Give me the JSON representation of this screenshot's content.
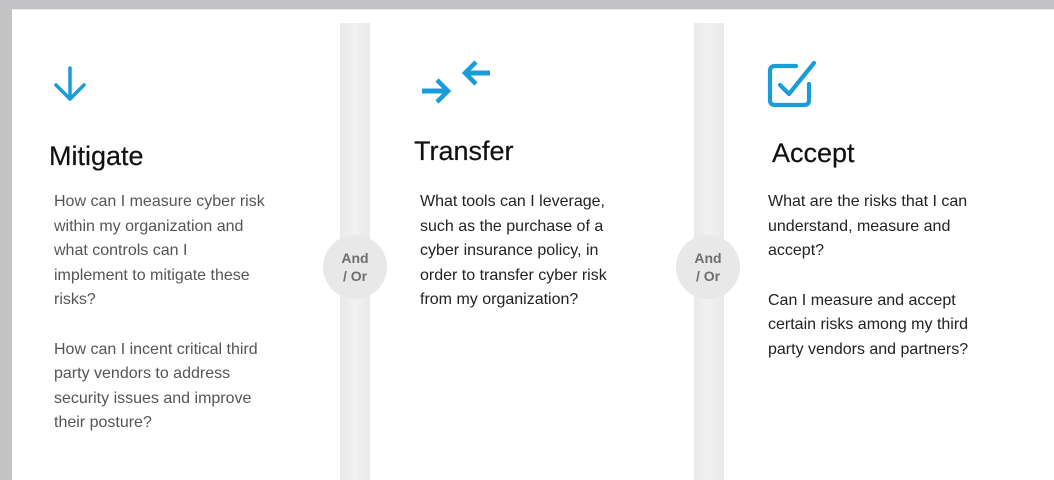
{
  "colors": {
    "accent": "#1a9cd8",
    "title_text": "#111111",
    "body_text_muted": "#555555",
    "body_text_dark": "#222222",
    "divider": "#ebebec",
    "connector_text": "#6e6e70"
  },
  "columns": [
    {
      "icon": "arrow-down-icon",
      "title": "Mitigate",
      "lines": [
        [
          "How can I measure cyber risk",
          "within my organization and",
          "what controls can I",
          "implement to mitigate these",
          "risks?"
        ],
        [
          "How can I incent critical third",
          "party vendors to address",
          "security issues and improve",
          "their posture?"
        ]
      ]
    },
    {
      "icon": "transfer-arrows-icon",
      "title": "Transfer",
      "lines": [
        [
          "What tools can I leverage,",
          "such as the purchase of a",
          "cyber insurance policy, in",
          "order to transfer cyber risk",
          "from my organization?"
        ]
      ]
    },
    {
      "icon": "checkbox-icon",
      "title": "Accept",
      "lines": [
        [
          "What are the risks that I can",
          "understand, measure and",
          "accept?"
        ],
        [
          "Can I measure and accept",
          "certain risks among my third",
          "party vendors and partners?"
        ]
      ]
    }
  ],
  "connectors": [
    {
      "line1": "And",
      "line2": "/ Or"
    },
    {
      "line1": "And",
      "line2": "/ Or"
    }
  ]
}
